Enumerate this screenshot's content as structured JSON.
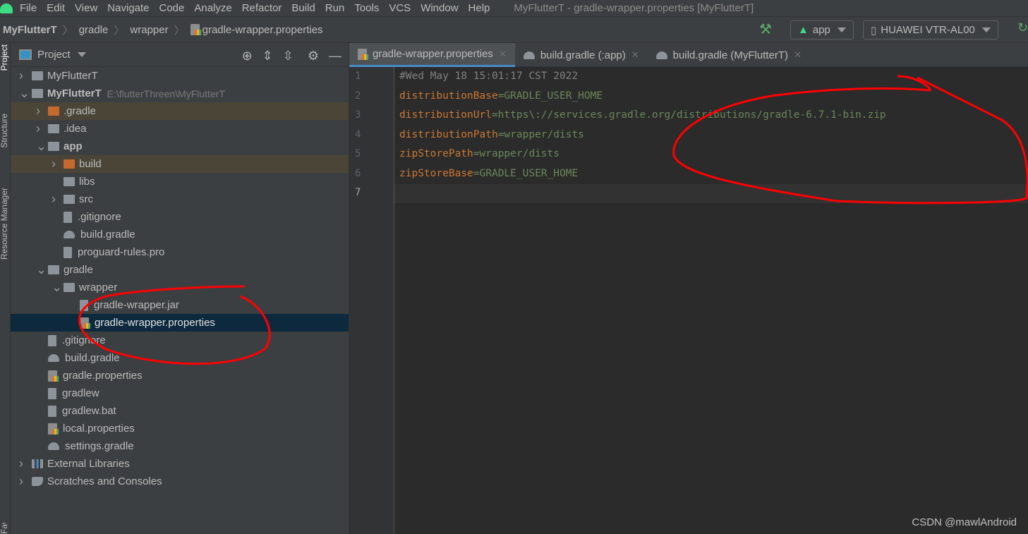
{
  "menubar": {
    "items": [
      "File",
      "Edit",
      "View",
      "Navigate",
      "Code",
      "Analyze",
      "Refactor",
      "Build",
      "Run",
      "Tools",
      "VCS",
      "Window",
      "Help"
    ],
    "window_title": "MyFlutterT - gradle-wrapper.properties [MyFlutterT]"
  },
  "breadcrumb": [
    "MyFlutterT",
    "gradle",
    "wrapper",
    "gradle-wrapper.properties"
  ],
  "toolbar": {
    "run_config": "app",
    "device": "HUAWEI VTR-AL00"
  },
  "side_strip": [
    "Project",
    "Structure",
    "Resource Manager",
    "Favorites"
  ],
  "project": {
    "title": "Project",
    "tree": [
      {
        "label": "MyFlutterT",
        "level": 0,
        "arrow": "›",
        "icon": "module"
      },
      {
        "label": "MyFlutterT",
        "path": "E:\\flutterThreen\\MyFlutterT",
        "level": 0,
        "arrow": "⌄",
        "icon": "module",
        "bold": true
      },
      {
        "label": ".gradle",
        "level": 1,
        "arrow": "›",
        "icon": "folder-excluded"
      },
      {
        "label": ".idea",
        "level": 1,
        "arrow": "›",
        "icon": "folder"
      },
      {
        "label": "app",
        "level": 1,
        "arrow": "⌄",
        "icon": "folder-module",
        "bold": true
      },
      {
        "label": "build",
        "level": 2,
        "arrow": "›",
        "icon": "folder-excluded"
      },
      {
        "label": "libs",
        "level": 2,
        "icon": "folder"
      },
      {
        "label": "src",
        "level": 2,
        "arrow": "›",
        "icon": "folder"
      },
      {
        "label": ".gitignore",
        "level": 2,
        "icon": "file"
      },
      {
        "label": "build.gradle",
        "level": 2,
        "icon": "gradle"
      },
      {
        "label": "proguard-rules.pro",
        "level": 2,
        "icon": "file"
      },
      {
        "label": "gradle",
        "level": 1,
        "arrow": "⌄",
        "icon": "folder"
      },
      {
        "label": "wrapper",
        "level": 2,
        "arrow": "⌄",
        "icon": "folder"
      },
      {
        "label": "gradle-wrapper.jar",
        "level": 3,
        "icon": "file"
      },
      {
        "label": "gradle-wrapper.properties",
        "level": 3,
        "icon": "properties",
        "selected": true
      },
      {
        "label": ".gitignore",
        "level": 1,
        "icon": "file"
      },
      {
        "label": "build.gradle",
        "level": 1,
        "icon": "gradle"
      },
      {
        "label": "gradle.properties",
        "level": 1,
        "icon": "properties"
      },
      {
        "label": "gradlew",
        "level": 1,
        "icon": "file"
      },
      {
        "label": "gradlew.bat",
        "level": 1,
        "icon": "file"
      },
      {
        "label": "local.properties",
        "level": 1,
        "icon": "properties"
      },
      {
        "label": "settings.gradle",
        "level": 1,
        "icon": "gradle"
      },
      {
        "label": "External Libraries",
        "level": 0,
        "arrow": "›",
        "icon": "library"
      },
      {
        "label": "Scratches and Consoles",
        "level": 0,
        "arrow": "›",
        "icon": "scratch"
      }
    ]
  },
  "tabs": [
    {
      "label": "gradle-wrapper.properties",
      "active": true,
      "icon": "properties"
    },
    {
      "label": "build.gradle (:app)",
      "icon": "gradle"
    },
    {
      "label": "build.gradle (MyFlutterT)",
      "icon": "gradle"
    }
  ],
  "editor": {
    "lines": [
      {
        "n": "1",
        "comment": "#Wed May 18 15:01:17 CST 2022"
      },
      {
        "n": "2",
        "key": "distributionBase",
        "value": "GRADLE_USER_HOME"
      },
      {
        "n": "3",
        "key": "distributionUrl",
        "value": "https\\://services.gradle.org/distributions/gradle-6.7.1-bin.zip"
      },
      {
        "n": "4",
        "key": "distributionPath",
        "value": "wrapper/dists"
      },
      {
        "n": "5",
        "key": "zipStorePath",
        "value": "wrapper/dists"
      },
      {
        "n": "6",
        "key": "zipStoreBase",
        "value": "GRADLE_USER_HOME"
      },
      {
        "n": "7"
      }
    ],
    "current_line": "7"
  },
  "watermark": "CSDN @mawlAndroid",
  "colors": {
    "key": "#cc7832",
    "value": "#6a8759",
    "comment": "#808080",
    "selection": "#0d293e",
    "annotation": "#ff0000"
  }
}
